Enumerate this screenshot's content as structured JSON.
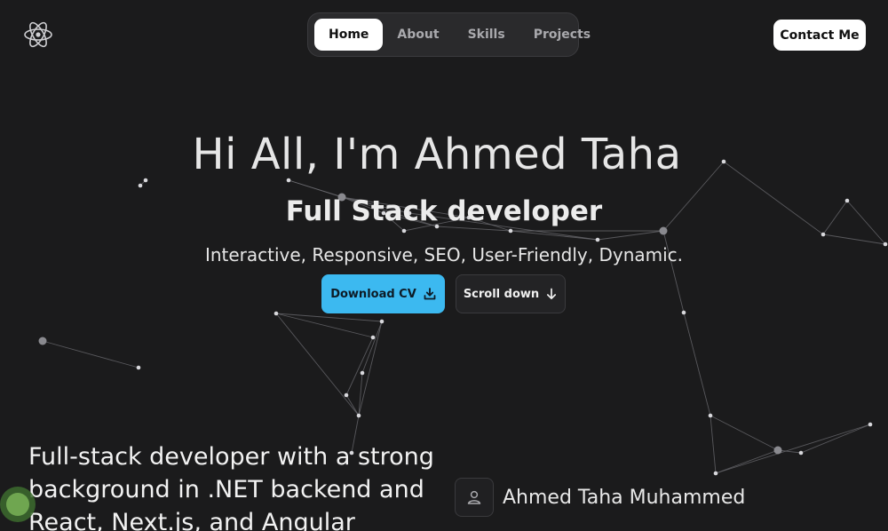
{
  "header": {
    "logo_icon": "atom-icon",
    "nav": [
      {
        "label": "Home",
        "active": true
      },
      {
        "label": "About",
        "active": false
      },
      {
        "label": "Skills",
        "active": false
      },
      {
        "label": "Projects",
        "active": false
      }
    ],
    "contact_label": "Contact Me"
  },
  "hero": {
    "title": "Hi All, I'm Ahmed Taha",
    "subtitle": "Full Stack developer",
    "tagline": "Interactive, Responsive, SEO, User-Friendly, Dynamic.",
    "download_label": "Download CV",
    "download_icon": "download-icon",
    "scroll_label": "Scroll down",
    "scroll_icon": "arrow-down-icon"
  },
  "about": {
    "summary": "Full-stack developer with a strong background in .NET backend and React, Next.js, and Angular",
    "name": "Ahmed Taha Muhammed",
    "avatar_icon": "user-icon"
  },
  "colors": {
    "background": "#1b1b1c",
    "accent": "#3cb9f0",
    "text": "#f2f2f2"
  }
}
